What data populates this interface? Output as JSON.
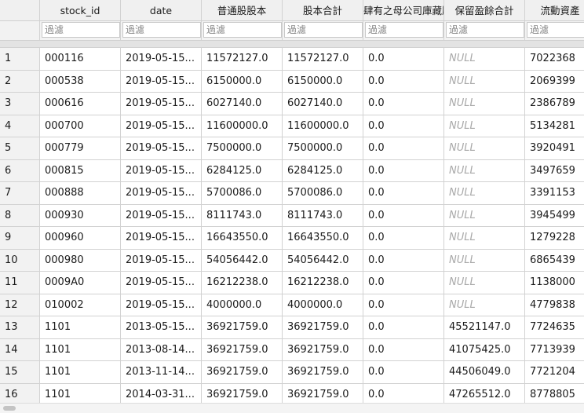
{
  "columns": [
    "",
    "stock_id",
    "date",
    "普通股股本",
    "股本合計",
    "歸屬於母公司業主之權益合計減庫藏股",
    "保留盈餘合計",
    "流動資產"
  ],
  "columns_display": [
    "",
    "stock_id",
    "date",
    "普通股股本",
    "股本合計",
    "肆有之母公司庫藏股",
    "保留盈餘合計",
    "流動資產"
  ],
  "filter_placeholder": "過濾",
  "rows": [
    {
      "n": "1",
      "stock_id": "000116",
      "date": "2019-05-15...",
      "c3": "11572127.0",
      "c4": "11572127.0",
      "c5": "0.0",
      "c6": "NULL",
      "c7": "7022368"
    },
    {
      "n": "2",
      "stock_id": "000538",
      "date": "2019-05-15...",
      "c3": "6150000.0",
      "c4": "6150000.0",
      "c5": "0.0",
      "c6": "NULL",
      "c7": "2069399"
    },
    {
      "n": "3",
      "stock_id": "000616",
      "date": "2019-05-15...",
      "c3": "6027140.0",
      "c4": "6027140.0",
      "c5": "0.0",
      "c6": "NULL",
      "c7": "2386789"
    },
    {
      "n": "4",
      "stock_id": "000700",
      "date": "2019-05-15...",
      "c3": "11600000.0",
      "c4": "11600000.0",
      "c5": "0.0",
      "c6": "NULL",
      "c7": "5134281"
    },
    {
      "n": "5",
      "stock_id": "000779",
      "date": "2019-05-15...",
      "c3": "7500000.0",
      "c4": "7500000.0",
      "c5": "0.0",
      "c6": "NULL",
      "c7": "3920491"
    },
    {
      "n": "6",
      "stock_id": "000815",
      "date": "2019-05-15...",
      "c3": "6284125.0",
      "c4": "6284125.0",
      "c5": "0.0",
      "c6": "NULL",
      "c7": "3497659"
    },
    {
      "n": "7",
      "stock_id": "000888",
      "date": "2019-05-15...",
      "c3": "5700086.0",
      "c4": "5700086.0",
      "c5": "0.0",
      "c6": "NULL",
      "c7": "3391153"
    },
    {
      "n": "8",
      "stock_id": "000930",
      "date": "2019-05-15...",
      "c3": "8111743.0",
      "c4": "8111743.0",
      "c5": "0.0",
      "c6": "NULL",
      "c7": "3945499"
    },
    {
      "n": "9",
      "stock_id": "000960",
      "date": "2019-05-15...",
      "c3": "16643550.0",
      "c4": "16643550.0",
      "c5": "0.0",
      "c6": "NULL",
      "c7": "1279228"
    },
    {
      "n": "10",
      "stock_id": "000980",
      "date": "2019-05-15...",
      "c3": "54056442.0",
      "c4": "54056442.0",
      "c5": "0.0",
      "c6": "NULL",
      "c7": "6865439"
    },
    {
      "n": "11",
      "stock_id": "0009A0",
      "date": "2019-05-15...",
      "c3": "16212238.0",
      "c4": "16212238.0",
      "c5": "0.0",
      "c6": "NULL",
      "c7": "1138000"
    },
    {
      "n": "12",
      "stock_id": "010002",
      "date": "2019-05-15...",
      "c3": "4000000.0",
      "c4": "4000000.0",
      "c5": "0.0",
      "c6": "NULL",
      "c7": "4779838"
    },
    {
      "n": "13",
      "stock_id": "1101",
      "date": "2013-05-15...",
      "c3": "36921759.0",
      "c4": "36921759.0",
      "c5": "0.0",
      "c6": "45521147.0",
      "c7": "7724635"
    },
    {
      "n": "14",
      "stock_id": "1101",
      "date": "2013-08-14...",
      "c3": "36921759.0",
      "c4": "36921759.0",
      "c5": "0.0",
      "c6": "41075425.0",
      "c7": "7713939"
    },
    {
      "n": "15",
      "stock_id": "1101",
      "date": "2013-11-14...",
      "c3": "36921759.0",
      "c4": "36921759.0",
      "c5": "0.0",
      "c6": "44506049.0",
      "c7": "7721204"
    },
    {
      "n": "16",
      "stock_id": "1101",
      "date": "2014-03-31...",
      "c3": "36921759.0",
      "c4": "36921759.0",
      "c5": "0.0",
      "c6": "47265512.0",
      "c7": "8778805"
    }
  ]
}
